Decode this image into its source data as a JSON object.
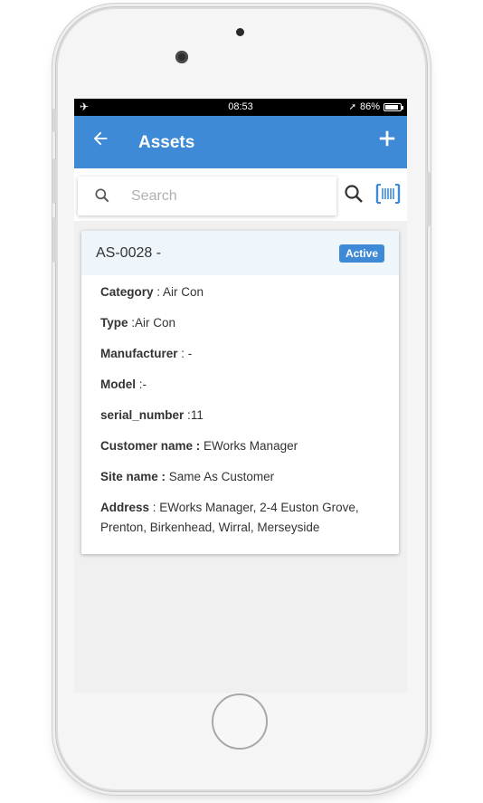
{
  "status_bar": {
    "time": "08:53",
    "battery": "86%",
    "battery_level": 0.86
  },
  "app_bar": {
    "title": "Assets",
    "back_icon": "arrow-left-icon",
    "add_icon": "plus-icon"
  },
  "search": {
    "placeholder": "Search",
    "value": ""
  },
  "colors": {
    "primary": "#3f8ad6",
    "card_header_bg": "#eef6fc"
  },
  "asset": {
    "code": "AS-0028 -",
    "status": "Active",
    "fields": [
      {
        "label": "Category",
        "sep": " : ",
        "value": "Air Con"
      },
      {
        "label": "Type",
        "sep": " :",
        "value": "Air Con"
      },
      {
        "label": "Manufacturer",
        "sep": " : ",
        "value": "-"
      },
      {
        "label": "Model",
        "sep": " :",
        "value": "-"
      },
      {
        "label": "serial_number",
        "sep": " :",
        "value": "11"
      },
      {
        "label": "Customer name :",
        "sep": " ",
        "value": "EWorks Manager"
      },
      {
        "label": "Site name :",
        "sep": " ",
        "value": "Same As Customer"
      },
      {
        "label": "Address",
        "sep": " : ",
        "value": "EWorks Manager, 2-4 Euston Grove, Prenton, Birkenhead, Wirral, Merseyside"
      }
    ]
  }
}
